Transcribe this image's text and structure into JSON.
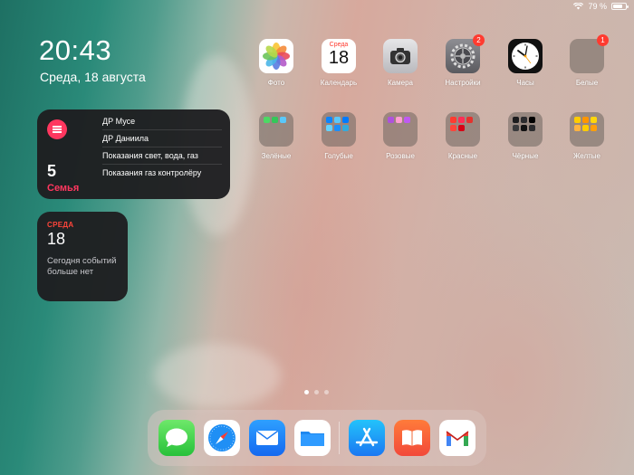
{
  "status": {
    "battery": "79 %",
    "battery_level": 0.79
  },
  "clock": {
    "time": "20:43",
    "date": "Среда, 18 августа"
  },
  "reminders_widget": {
    "count": "5",
    "list_name": "Семья",
    "items": [
      "ДР Мусе",
      "ДР Даниила",
      "Показания свет, вода, газ",
      "Показания газ контролёру"
    ]
  },
  "calendar_widget": {
    "weekday": "СРЕДА",
    "day": "18",
    "note": "Сегодня событий больше нет"
  },
  "apps": {
    "photos": {
      "label": "Фото"
    },
    "calendar": {
      "label": "Календарь",
      "weekday": "Среда",
      "day": "18"
    },
    "camera": {
      "label": "Камера"
    },
    "settings": {
      "label": "Настройки",
      "badge": "2"
    },
    "clock": {
      "label": "Часы"
    },
    "folder_white": {
      "label": "Белые",
      "badge": "1"
    },
    "folder_green": {
      "label": "Зелёные"
    },
    "folder_blue": {
      "label": "Голубые"
    },
    "folder_pink": {
      "label": "Розовые"
    },
    "folder_red": {
      "label": "Красные"
    },
    "folder_black": {
      "label": "Чёрные"
    },
    "folder_yellow": {
      "label": "Желтые"
    }
  },
  "page_indicator": {
    "pages": 3,
    "current": 1
  },
  "dock": {
    "apps": [
      "messages-icon",
      "safari-icon",
      "mail-icon",
      "files-icon",
      "app-store-icon",
      "books-icon",
      "gmail-icon"
    ]
  },
  "colors": {
    "accent_red": "#ff3b30",
    "reminders_pink": "#ff375f"
  }
}
